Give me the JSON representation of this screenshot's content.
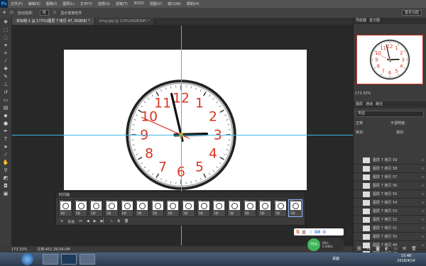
{
  "app": {
    "logo": "Ps"
  },
  "menubar": {
    "items": [
      "文件(F)",
      "编辑(E)",
      "图像(I)",
      "图层(L)",
      "文字(Y)",
      "选择(S)",
      "滤镜(T)",
      "3D(D)",
      "视图(V)",
      "窗口(W)",
      "帮助(H)"
    ]
  },
  "options": {
    "auto_select_label": "自动选择：",
    "auto_select_value": "组",
    "show_transform_label": "显示变换控件",
    "workspace": "基本功能"
  },
  "doc_tabs": [
    {
      "label": "未标题-1 @ 173%(图层 7 拷贝 47, RGB/8) *",
      "active": true
    },
    {
      "label": "timg.jpg @ 116%(RGB/8#) *",
      "active": false
    }
  ],
  "clock": {
    "numbers": [
      "12",
      "1",
      "2",
      "3",
      "4",
      "5",
      "6",
      "7",
      "8",
      "9",
      "10",
      "11"
    ],
    "hour": 2,
    "minute": 57,
    "second": 49
  },
  "timeline": {
    "title": "时间轴",
    "frames": [
      {
        "num": "35",
        "delay": "1秒"
      },
      {
        "num": "36",
        "delay": "1秒"
      },
      {
        "num": "37",
        "delay": "1秒"
      },
      {
        "num": "38",
        "delay": "1秒"
      },
      {
        "num": "39",
        "delay": "1秒"
      },
      {
        "num": "40",
        "delay": "1秒"
      },
      {
        "num": "41",
        "delay": "1秒"
      },
      {
        "num": "42",
        "delay": "1秒"
      },
      {
        "num": "43",
        "delay": "1秒"
      },
      {
        "num": "44",
        "delay": "1秒"
      },
      {
        "num": "45",
        "delay": "1秒"
      },
      {
        "num": "46",
        "delay": "1秒"
      },
      {
        "num": "47",
        "delay": "1秒"
      },
      {
        "num": "48",
        "delay": "1秒"
      },
      {
        "num": "49",
        "delay": "1秒"
      },
      {
        "num": "50",
        "delay": "1秒"
      }
    ],
    "selected_index": 15,
    "loop_label": "永远"
  },
  "status": {
    "zoom": "173.33%",
    "doc": "文档:452.2K/34.0M"
  },
  "navigator": {
    "tabs": [
      "导航器",
      "直方图"
    ],
    "zoom": "173.33%"
  },
  "layers": {
    "tabs": [
      "图层",
      "通道",
      "路径"
    ],
    "filter": "类型",
    "blend": "正常",
    "opacity": "不透明度:",
    "lock": "锁定:",
    "fill": "填充:",
    "rows": [
      {
        "name": "图层 7 拷贝 59"
      },
      {
        "name": "图层 7 拷贝 58"
      },
      {
        "name": "图层 7 拷贝 57"
      },
      {
        "name": "图层 7 拷贝 56"
      },
      {
        "name": "图层 7 拷贝 55"
      },
      {
        "name": "图层 7 拷贝 54"
      },
      {
        "name": "图层 7 拷贝 53"
      },
      {
        "name": "图层 7 拷贝 52"
      },
      {
        "name": "图层 7 拷贝 51"
      },
      {
        "name": "图层 7 拷贝 50"
      },
      {
        "name": "图层 7 拷贝 49"
      },
      {
        "name": "图层 7 拷贝 48"
      }
    ]
  },
  "ime": {
    "label": "英"
  },
  "network": {
    "percent": "75%",
    "up": "0K/s",
    "down": "0.09K/s"
  },
  "taskbar": {
    "tray": "桌面",
    "time": "15:48",
    "date": "2016/4/14"
  }
}
